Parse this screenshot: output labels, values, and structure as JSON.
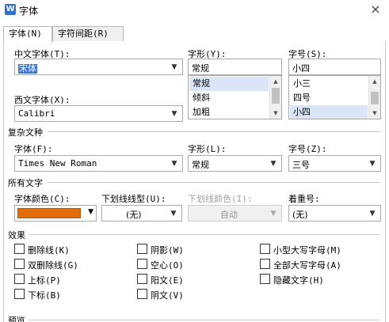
{
  "window": {
    "title": "字体",
    "app_icon_letter": "W",
    "close": "×"
  },
  "tabs": [
    {
      "label": "字体(N)"
    },
    {
      "label": "字符间距(R)"
    }
  ],
  "chinese_font": {
    "label": "中文字体(T):",
    "value": "宋体"
  },
  "style": {
    "label": "字形(Y):",
    "value": "常规",
    "options": [
      "常规",
      "倾斜",
      "加粗"
    ],
    "selected_index": 0
  },
  "size": {
    "label": "字号(S):",
    "value": "小四",
    "options": [
      "小三",
      "四号",
      "小四"
    ],
    "selected_index": 2
  },
  "western_font": {
    "label": "西文字体(X):",
    "value": "Calibri"
  },
  "complex": {
    "group_title": "复杂文种",
    "font_label": "字体(F):",
    "font_value": "Times New Roman",
    "style_label": "字形(L):",
    "style_value": "常规",
    "size_label": "字号(Z):",
    "size_value": "三号"
  },
  "all_text": {
    "group_title": "所有文字",
    "color_label": "字体颜色(C):",
    "color_value": "#e36c09",
    "underline_label": "下划线线型(U):",
    "underline_value": "(无)",
    "underline_color_label": "下划线颜色(I):",
    "underline_color_value": "自动",
    "emphasis_label": "着重号:",
    "emphasis_value": "(无)"
  },
  "effects": {
    "group_title": "效果",
    "items": [
      "删除线(K)",
      "双删除线(G)",
      "上标(P)",
      "下标(B)",
      "阴影(W)",
      "空心(O)",
      "阳文(E)",
      "阴文(V)",
      "小型大写字母(M)",
      "全部大写字母(A)",
      "隐藏文字(H)"
    ]
  },
  "preview": {
    "group_title": "预览"
  },
  "icons": {
    "dropdown": "chevron-down-icon",
    "scroll_up": "scroll-up-icon",
    "scroll_down": "scroll-down-icon"
  }
}
